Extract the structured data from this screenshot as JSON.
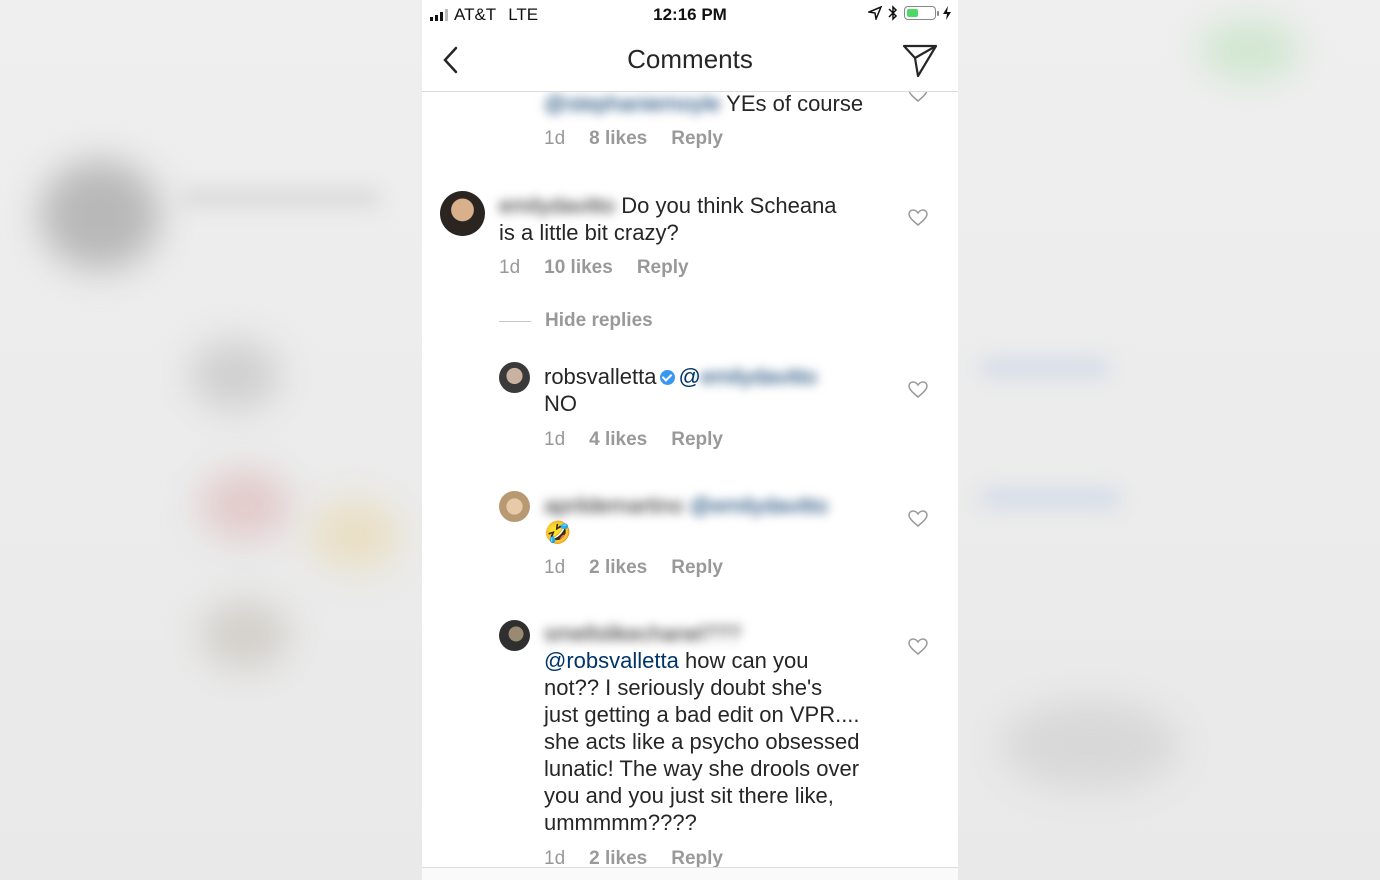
{
  "status_bar": {
    "carrier": "AT&T",
    "network": "LTE",
    "time": "12:16 PM"
  },
  "header": {
    "title": "Comments",
    "back_icon": "chevron-left-icon",
    "send_icon": "paper-plane-icon"
  },
  "comments": [
    {
      "id": "c0",
      "username": "@stephaniemoyle",
      "text": "YEs of course",
      "time": "1d",
      "likes": "8 likes",
      "reply": "Reply"
    },
    {
      "id": "c1",
      "username": "emilydavitto",
      "text_line1": "Do you think Scheana",
      "text_line2": "is a little  bit crazy?",
      "time": "1d",
      "likes": "10 likes",
      "reply": "Reply",
      "hide_replies": "Hide replies"
    },
    {
      "id": "c2",
      "username": "robsvalletta",
      "at": "@",
      "mention": "emilydavitto",
      "text": "NO",
      "time": "1d",
      "likes": "4 likes",
      "reply": "Reply"
    },
    {
      "id": "c3",
      "username": "aprildemartino",
      "mention": "@emilydavitto",
      "text": "🤣",
      "time": "1d",
      "likes": "2 likes",
      "reply": "Reply"
    },
    {
      "id": "c4",
      "username": "smellslikechanel???",
      "mention": "@robsvalletta",
      "lines": [
        "how can you",
        "not?? I seriously doubt she's",
        "just getting a bad edit on VPR....",
        "she acts like a psycho obsessed",
        "lunatic! The way she drools over",
        "you and you just sit there like,",
        "ummmmm????"
      ],
      "time": "1d",
      "likes": "2 likes",
      "reply": "Reply"
    }
  ]
}
